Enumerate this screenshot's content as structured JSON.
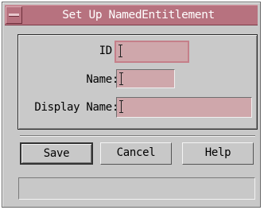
{
  "window": {
    "title": "Set Up NamedEntitlement"
  },
  "form": {
    "fields": [
      {
        "label": "ID:",
        "value": ""
      },
      {
        "label": "Name:",
        "value": ""
      },
      {
        "label": "Display Name:",
        "value": ""
      }
    ]
  },
  "buttons": {
    "save": "Save",
    "cancel": "Cancel",
    "help": "Help"
  },
  "status": {
    "message": ""
  },
  "colors": {
    "titlebar": "#b7727f",
    "field_bg": "#cfa7ab",
    "window_bg": "#c8c8c8"
  }
}
